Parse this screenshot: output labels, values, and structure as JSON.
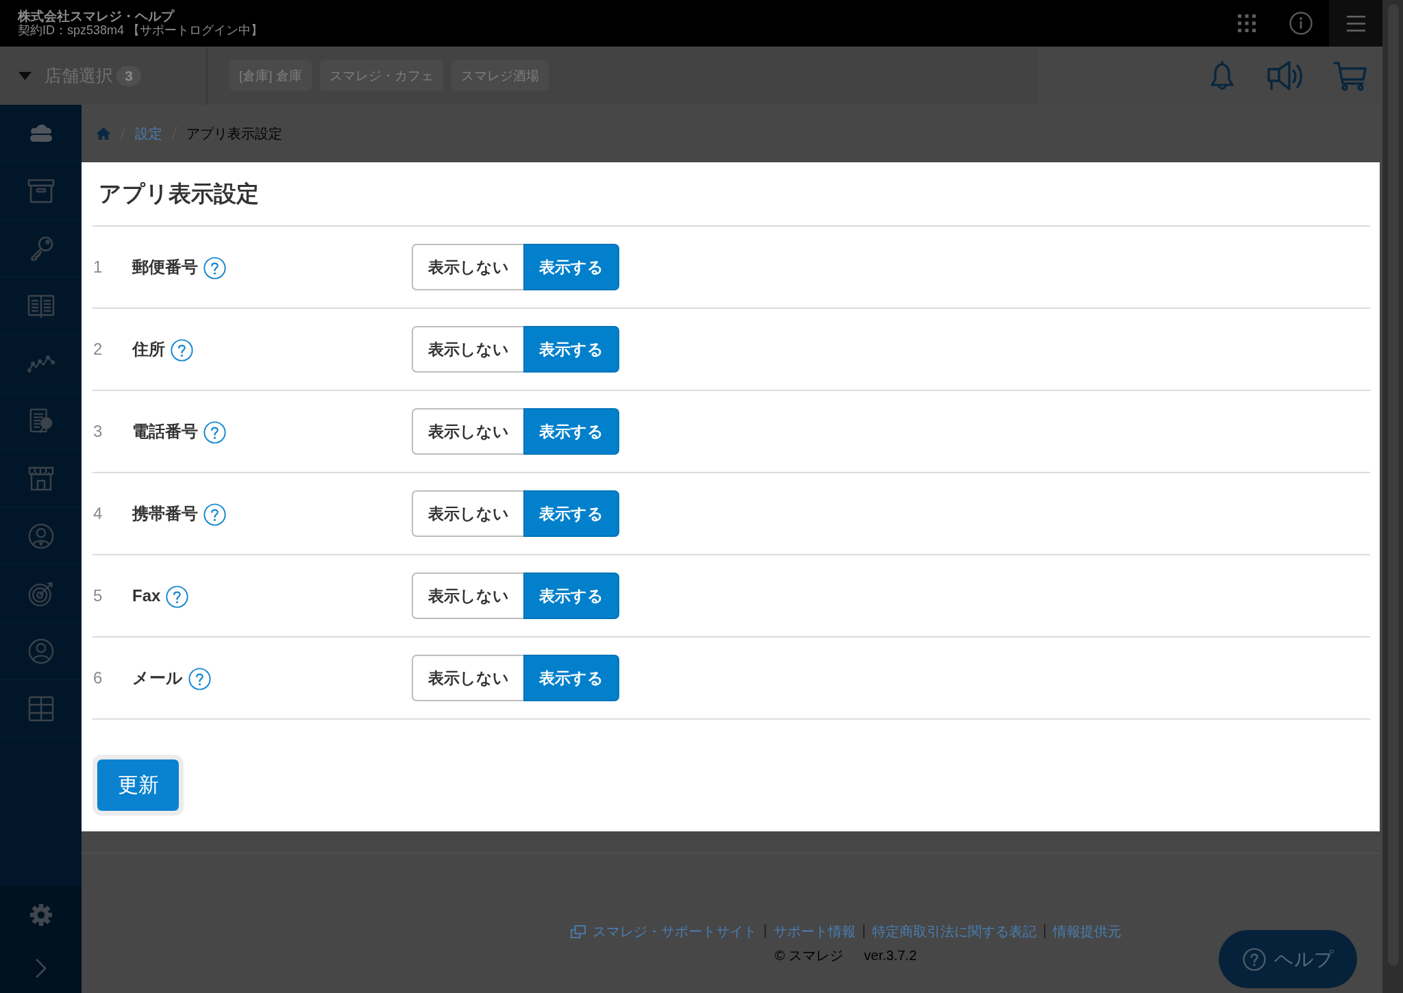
{
  "header": {
    "company": "株式会社スマレジ・ヘルプ",
    "contract": "契約ID：spz538m4 【サポートログイン中】"
  },
  "store_bar": {
    "label": "店舗選択",
    "count": "3",
    "stores": [
      "[倉庫] 倉庫",
      "スマレジ・カフェ",
      "スマレジ酒場"
    ]
  },
  "breadcrumb": [
    {
      "label": "設定",
      "kind": "link"
    },
    {
      "label": "アプリ表示設定",
      "kind": "current"
    }
  ],
  "panel": {
    "title": "アプリ表示設定",
    "rows": [
      {
        "number": "1",
        "label": "郵便番号",
        "options": [
          {
            "label": "表示しない",
            "selected": false
          },
          {
            "label": "表示する",
            "selected": true
          }
        ]
      },
      {
        "number": "2",
        "label": "住所",
        "options": [
          {
            "label": "表示しない",
            "selected": false
          },
          {
            "label": "表示する",
            "selected": true
          }
        ]
      },
      {
        "number": "3",
        "label": "電話番号",
        "options": [
          {
            "label": "表示しない",
            "selected": false
          },
          {
            "label": "表示する",
            "selected": true
          }
        ]
      },
      {
        "number": "4",
        "label": "携帯番号",
        "options": [
          {
            "label": "表示しない",
            "selected": false
          },
          {
            "label": "表示する",
            "selected": true
          }
        ]
      },
      {
        "number": "5",
        "label": "Fax",
        "options": [
          {
            "label": "表示しない",
            "selected": false
          },
          {
            "label": "表示する",
            "selected": true
          }
        ]
      },
      {
        "number": "6",
        "label": "メール",
        "options": [
          {
            "label": "表示しない",
            "selected": false
          },
          {
            "label": "表示する",
            "selected": true
          }
        ]
      }
    ],
    "submit": "更新"
  },
  "footer": {
    "links": [
      {
        "label": "スマレジ・サポートサイト",
        "kind": "external"
      },
      {
        "label": "サポート情報",
        "kind": "internal"
      },
      {
        "label": "特定商取引法に関する表記",
        "kind": "internal"
      },
      {
        "label": "情報提供元",
        "kind": "internal"
      }
    ],
    "copyright": "© スマレジ",
    "version": "ver.3.7.2"
  },
  "help_button": {
    "label": "ヘルプ"
  }
}
